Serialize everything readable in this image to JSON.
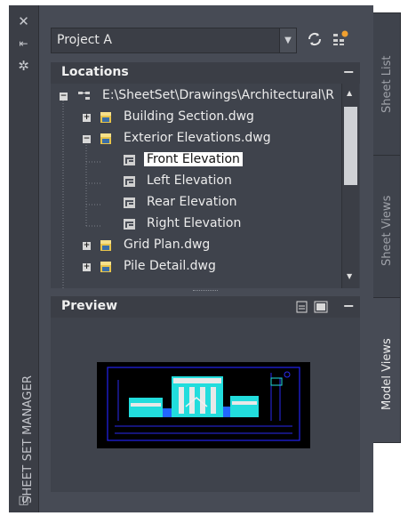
{
  "palette": {
    "app_background": "#474b55",
    "header_background": "#3b3e46",
    "tree_background": "#3f434c",
    "selection": "#ffffff"
  },
  "side_strip": {
    "title": "SHEET SET MANAGER",
    "buttons": [
      "close-icon",
      "auto-hide-icon",
      "properties-icon"
    ]
  },
  "project_selector": {
    "value": "Project A",
    "icons": [
      "refresh-icon",
      "sheet-set-options-icon"
    ]
  },
  "locations": {
    "title": "Locations",
    "minimize_label": "−",
    "tree": [
      {
        "label": "E:\\SheetSet\\Drawings\\Architectural\\R",
        "type": "folder",
        "expander": "−",
        "level": 0
      },
      {
        "label": "Building Section.dwg",
        "type": "drawing",
        "expander": "+",
        "level": 1
      },
      {
        "label": "Exterior Elevations.dwg",
        "type": "drawing",
        "expander": "−",
        "level": 1
      },
      {
        "label": "Front Elevation",
        "type": "view",
        "selected": true,
        "level": 2
      },
      {
        "label": "Left Elevation",
        "type": "view",
        "level": 2
      },
      {
        "label": "Rear Elevation",
        "type": "view",
        "level": 2
      },
      {
        "label": "Right Elevation",
        "type": "view",
        "level": 2
      },
      {
        "label": "Grid Plan.dwg",
        "type": "drawing",
        "expander": "+",
        "level": 1
      },
      {
        "label": "Pile Detail.dwg",
        "type": "drawing",
        "expander": "+",
        "level": 1
      }
    ]
  },
  "preview": {
    "title": "Preview",
    "minimize_label": "−",
    "icons": [
      "details-icon",
      "preview-icon"
    ]
  },
  "tabs": [
    {
      "label": "Sheet List",
      "active": false
    },
    {
      "label": "Sheet Views",
      "active": false
    },
    {
      "label": "Model Views",
      "active": true
    }
  ]
}
